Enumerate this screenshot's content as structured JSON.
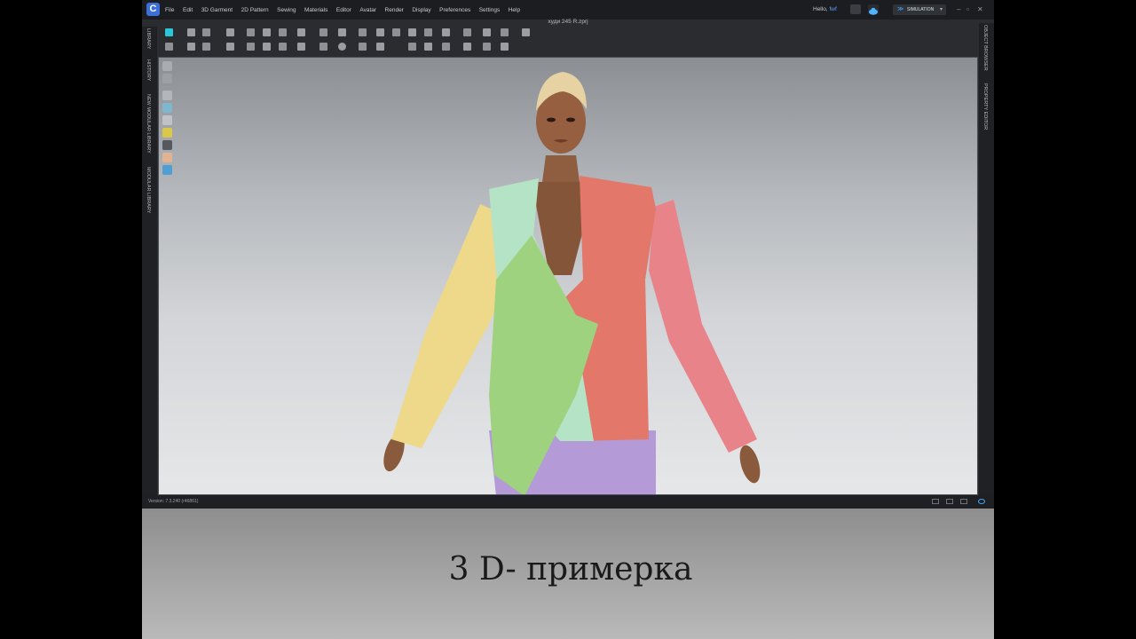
{
  "menubar": {
    "logo": "C",
    "items": [
      "File",
      "Edit",
      "3D Garment",
      "2D Pattern",
      "Sewing",
      "Materials",
      "Editor",
      "Avatar",
      "Render",
      "Display",
      "Preferences",
      "Settings",
      "Help"
    ],
    "greeting": "Hello,",
    "username": "fwf",
    "mode_label": "SIMULATION"
  },
  "file": {
    "title": "худи 245 R.zprj"
  },
  "left_tabs": [
    "LIBRARY",
    "HISTORY",
    "NEW MODULAR LIBRARY",
    "MODULAR LIBRARY"
  ],
  "right_tabs": [
    "OBJECT BROWSER",
    "PROPERTY EDITOR"
  ],
  "status": {
    "version": "Version: 7.3.240 (r46861)"
  },
  "caption": {
    "text": "3 D- примерка"
  },
  "colors": {
    "accent": "#45a6ff",
    "garment_green": "#9fd27f",
    "garment_mint": "#b5e3c6",
    "garment_red": "#e2776a",
    "garment_yellow": "#eed88a",
    "garment_pink": "#e8838a",
    "trousers": "#b49ad6"
  }
}
